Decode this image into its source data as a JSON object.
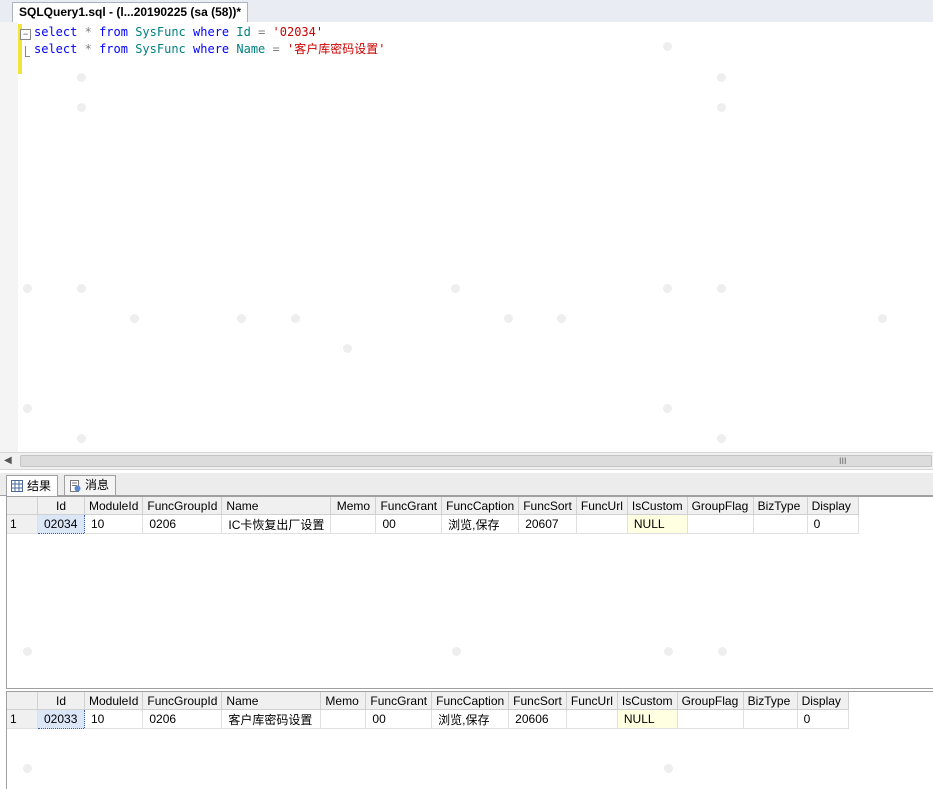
{
  "tab": {
    "title": "SQLQuery1.sql - (l...20190225 (sa (58))*"
  },
  "editor": {
    "lines": [
      {
        "kw1": "select",
        "star": "*",
        "kw2": "from",
        "table": "SysFunc",
        "kw3": "where",
        "col": "Id",
        "eq": "=",
        "value": "'02034'"
      },
      {
        "kw1": "select",
        "star": "*",
        "kw2": "from",
        "table": "SysFunc",
        "kw3": "where",
        "col": "Name",
        "eq": "=",
        "value": "'客户库密码设置'"
      }
    ]
  },
  "scrollbar": {
    "grip": "III"
  },
  "results_tabs": {
    "results": "结果",
    "messages": "消息"
  },
  "grids": [
    {
      "columns": [
        "",
        "Id",
        "ModuleId",
        "FuncGroupId",
        "Name",
        "Memo",
        "FuncGrant",
        "FuncCaption",
        "FuncSort",
        "FuncUrl",
        "IsCustom",
        "GroupFlag",
        "BizType",
        "Display"
      ],
      "row": [
        "1",
        "02034",
        "10",
        "0206",
        "IC卡恢复出厂设置",
        "",
        "00",
        "浏览,保存",
        "20607",
        "",
        "NULL",
        "",
        "",
        "0"
      ]
    },
    {
      "columns": [
        "",
        "Id",
        "ModuleId",
        "FuncGroupId",
        "Name",
        "Memo",
        "FuncGrant",
        "FuncCaption",
        "FuncSort",
        "FuncUrl",
        "IsCustom",
        "GroupFlag",
        "BizType",
        "Display"
      ],
      "row": [
        "1",
        "02033",
        "10",
        "0206",
        "客户库密码设置",
        "",
        "00",
        "浏览,保存",
        "20606",
        "",
        "NULL",
        "",
        "",
        "0"
      ]
    }
  ]
}
